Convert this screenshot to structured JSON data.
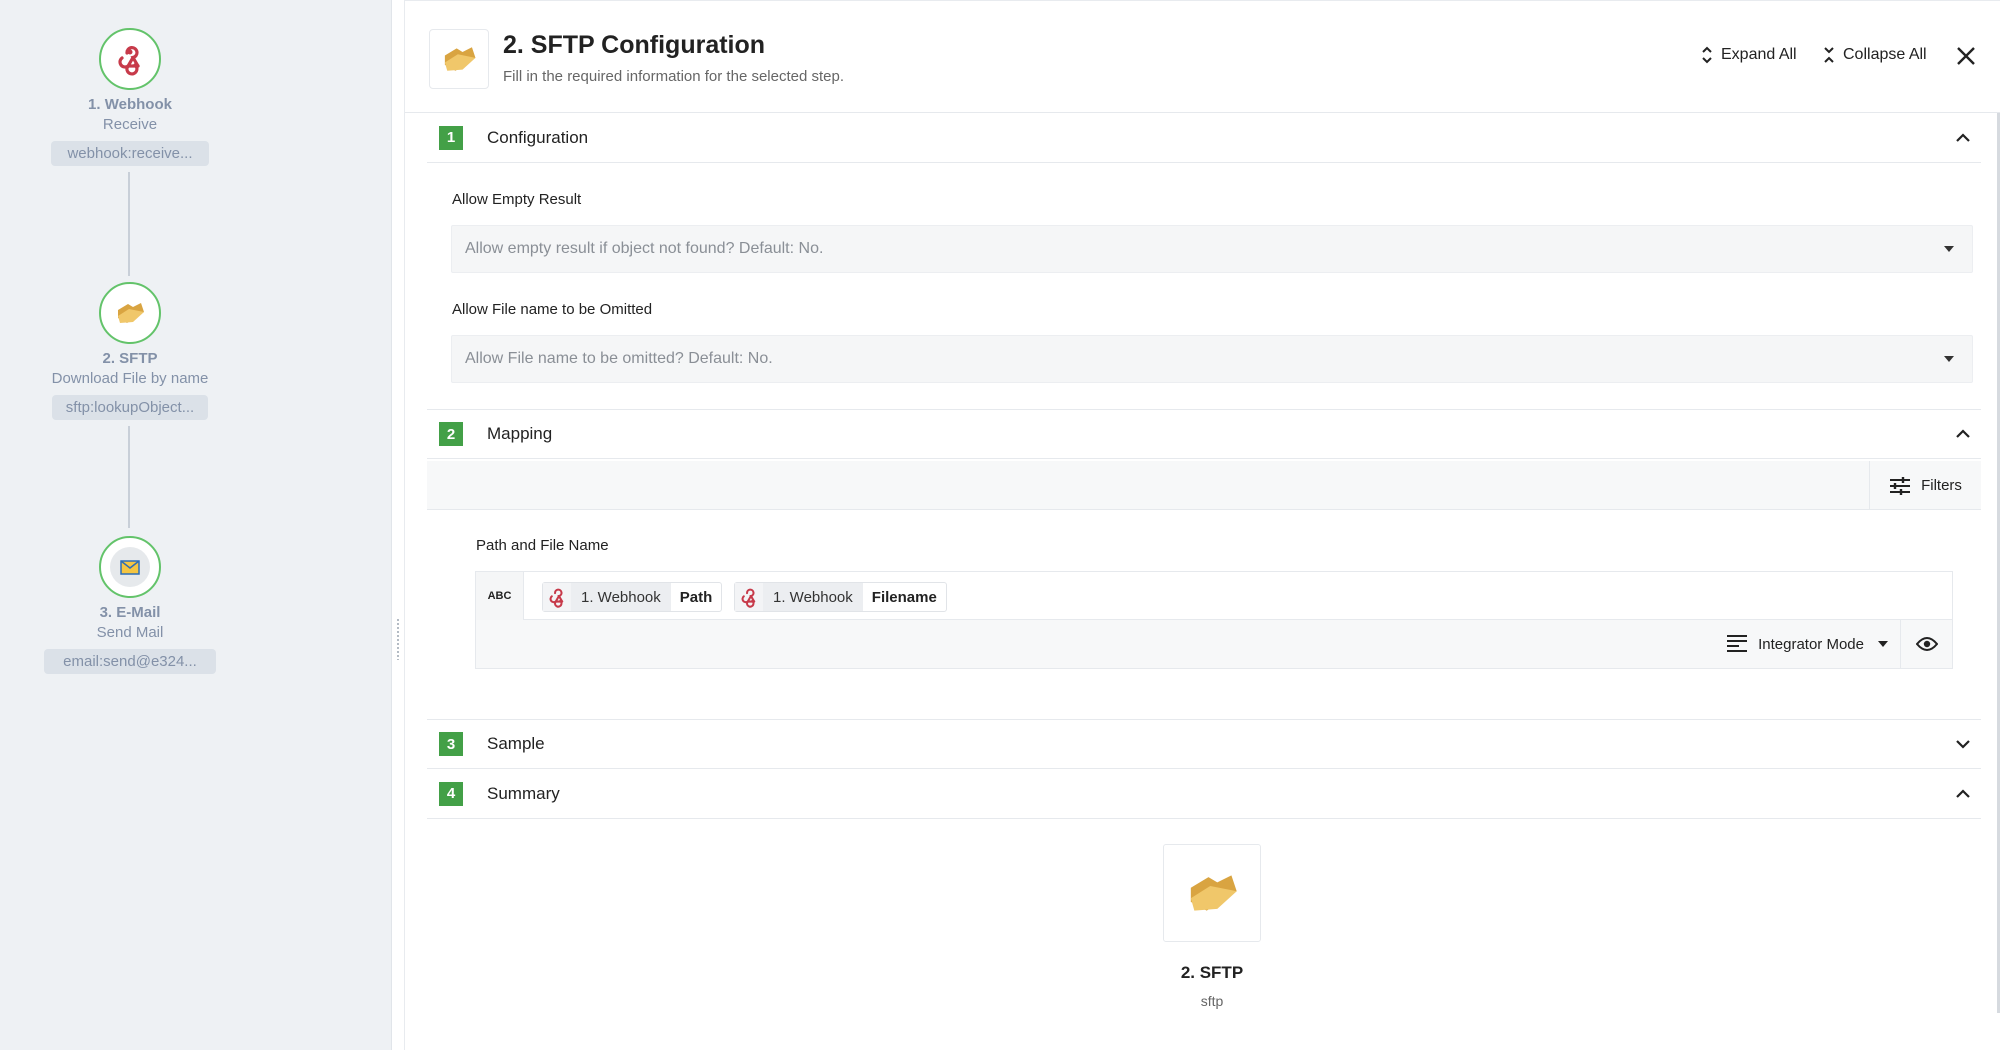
{
  "flow": {
    "nodes": [
      {
        "title": "1. Webhook",
        "subtitle": "Receive",
        "chip": "webhook:receive...",
        "icon": "webhook-icon"
      },
      {
        "title": "2. SFTP",
        "subtitle": "Download File by name",
        "chip": "sftp:lookupObject...",
        "icon": "folder-icon"
      },
      {
        "title": "3. E-Mail",
        "subtitle": "Send Mail",
        "chip": "email:send@e324...",
        "icon": "envelope-icon"
      }
    ]
  },
  "header": {
    "title": "2. SFTP Configuration",
    "subtitle": "Fill in the required information for the selected step.",
    "expand_all": "Expand All",
    "collapse_all": "Collapse All"
  },
  "sections": {
    "configuration": {
      "number": "1",
      "label": "Configuration",
      "expanded": true
    },
    "mapping": {
      "number": "2",
      "label": "Mapping",
      "expanded": true
    },
    "sample": {
      "number": "3",
      "label": "Sample",
      "expanded": false
    },
    "summary": {
      "number": "4",
      "label": "Summary",
      "expanded": true
    }
  },
  "configuration": {
    "allow_empty_label": "Allow Empty Result",
    "allow_empty_placeholder": "Allow empty result if object not found? Default: No.",
    "allow_omit_label": "Allow File name to be Omitted",
    "allow_omit_placeholder": "Allow File name to be omitted? Default: No."
  },
  "mapping": {
    "filters_label": "Filters",
    "path_label": "Path and File Name",
    "type_badge": "ABC",
    "tokens": [
      {
        "source": "1. Webhook",
        "field": "Path"
      },
      {
        "source": "1. Webhook",
        "field": "Filename"
      }
    ],
    "mode_label": "Integrator Mode"
  },
  "summary": {
    "title": "2. SFTP",
    "subtitle": "sftp"
  },
  "colors": {
    "accent_green": "#43a047",
    "node_border": "#63c36a",
    "webhook_red": "#c73a4a"
  }
}
